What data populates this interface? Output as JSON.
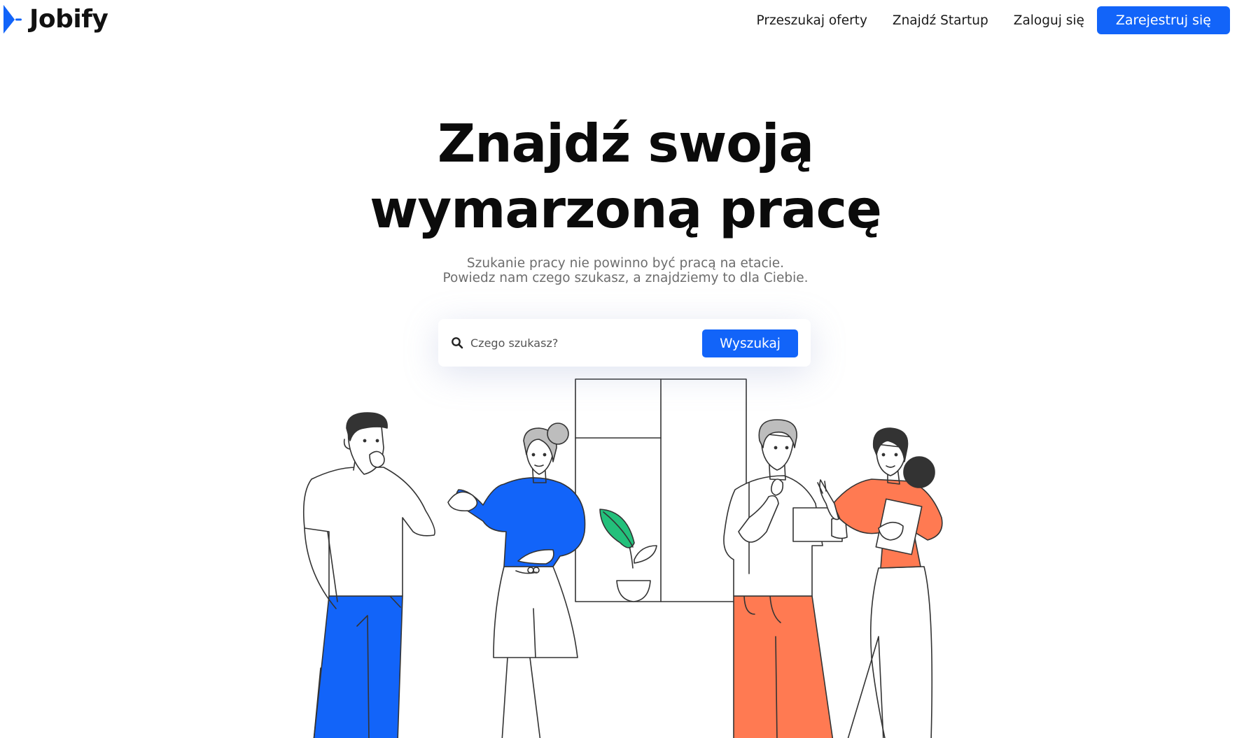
{
  "header": {
    "logo_text": "Jobify",
    "logo_icon": "jobify-logo-mark",
    "nav": [
      {
        "label": "Przeszukaj oferty"
      },
      {
        "label": "Znajdź Startup"
      },
      {
        "label": "Zaloguj się"
      }
    ],
    "register_label": "Zarejestruj się"
  },
  "hero": {
    "title_line1": "Znajdź swoją",
    "title_line2": "wymarzoną pracę",
    "subtitle_line1": "Szukanie pracy nie powinno być pracą na etacie.",
    "subtitle_line2": "Powiedz nam czego szukasz, a znajdziemy to dla Ciebie."
  },
  "search": {
    "icon": "search-icon",
    "placeholder": "Czego szukasz?",
    "value": "",
    "button_label": "Wyszukaj"
  },
  "colors": {
    "accent": "#1264f9",
    "orange": "#ff7a52",
    "green": "#23c07b",
    "text_dark": "#0b0b0b",
    "text_muted": "#6d6d6d"
  }
}
